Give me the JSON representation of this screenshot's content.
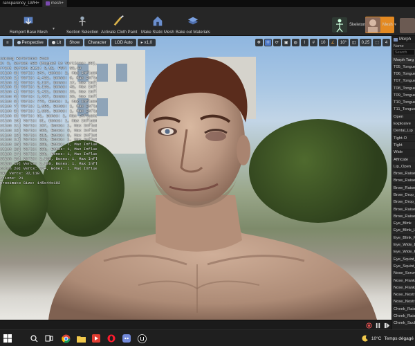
{
  "tabs": [
    {
      "label": "ransparency_LWH+",
      "active": false
    },
    {
      "label": "mesh+",
      "active": true
    }
  ],
  "toolbar": {
    "remport": "Remport Base Mesh",
    "section_selection": "Section Selection",
    "activate_cloth": "Activate Cloth Paint",
    "make_static": "Make Static Mesh",
    "bake_out": "Bake out Materials",
    "skeleton": "Skeleton",
    "mesh": "Mesh"
  },
  "viewport_toolbar": {
    "perspective": "Perspective",
    "lit": "Lit",
    "show": "Show",
    "character": "Character",
    "lod": "LOD Auto",
    "speed": "x1,0",
    "grid_snap": "10",
    "angle_snap": "10°",
    "scale_snap": "0,25",
    "camera_speed": "4"
  },
  "stats": [
    "iewing Reference Pose",
    "D: 0, Screen 598 (Mapped to Vertices: 99), Polys: 5347I",
    "rrent Screen Size: 3,52, FOV: 53,43",
    "ction 0] Verts: 347, Bones: 2, Max Influences: 2",
    "ction 1] Verts: 4,452, Bones: 9, Max Influences: 4",
    "ction 2] Verts: 3,197, Bones: 17, Max Influences: 4",
    "ction 3] Verts: 5,155, Bones: 48, Max Influences: 4",
    "ction 4] Verts: 2,421, Bones: 23, Max Influences: 4",
    "ction 5] Verts: 1,227, Bones: 20, Max Influences: 4",
    "ction 6] Verts: 773, Bones: 1, Max Influences: 1",
    "ction 7] Verts: 1,583, Bones: 1, Max Influences: 1",
    "ction 8] Verts: 1,553, Bones: 1, Max Influences: 1",
    "ction 9] Verts: 91, Bones: 1, Max Influences: 1",
    "ction 10] Verts: 91, Bones: 1, Max Influences: 1",
    "ction 11] Verts: 197, Bones: 1, Max Influences: 1",
    "ction 12] Verts: 580, Bones: 9, Max Influences: 4",
    "ction 13] Verts: 818, Bones: 6, Max Influences: 4",
    "ction 14] Verts: 396, Bones: 1, Max Influences: 1",
    "ction 15] Verts: 206, Bones: 1, Max Influences: 1",
    "ction 16] Verts: 396, Bones: 1, Max Influences: 1",
    "ction 17] Verts: 206, Bones: 1, Max Influences: 1",
    "ction 18] Verts: 1,180, Bones: 1, Max Influences: 1",
    "ction 19] Verts: 1,180, Bones: 1, Max Influences: 1",
    "ction 20] Verts: 224, Bones: 1, Max Influences: 1",
    "TAL Verts: 32,118",
    "ctions: 21",
    "proximate Size: 145x44x192"
  ],
  "right_panel": {
    "title": "Morph",
    "sub": "Name",
    "search_placeholder": "Search",
    "column": "Morph Targ",
    "items": [
      "T05_Tongue",
      "T06_Tongue",
      "T07_Tongue",
      "T08_Tongue",
      "T09_Tongue",
      "T10_Tongue",
      "T11_Tongue",
      "Open",
      "Explosive",
      "Dental_Lip",
      "Tight-O",
      "Tight",
      "Wide",
      "Affricate",
      "Lip_Open",
      "Brow_Raise",
      "Brow_Raise",
      "Brow_Raise",
      "Brow_Drop_",
      "Brow_Drop_",
      "Brow_Raise",
      "Brow_Raise",
      "Eye_Blink",
      "Eye_Blink_L",
      "Eye_Blink_R",
      "Eye_Wide_L",
      "Eye_Wide_R",
      "Eye_Squint_",
      "Eye_Squint_",
      "Nose_Scrun",
      "Nose_Flank",
      "Nose_Flank",
      "Nose_Nostri",
      "Nose_Nostri",
      "Cheek_Raise",
      "Cheek_Raise",
      "Cheek_Suck"
    ]
  },
  "taskbar": {
    "temperature": "10°C",
    "weather_text": "Temps dégagé"
  },
  "colors": {
    "accent_blue": "#4c78c8",
    "mesh_active": "#e48a22",
    "cloth_gold": "#d8b04a"
  }
}
